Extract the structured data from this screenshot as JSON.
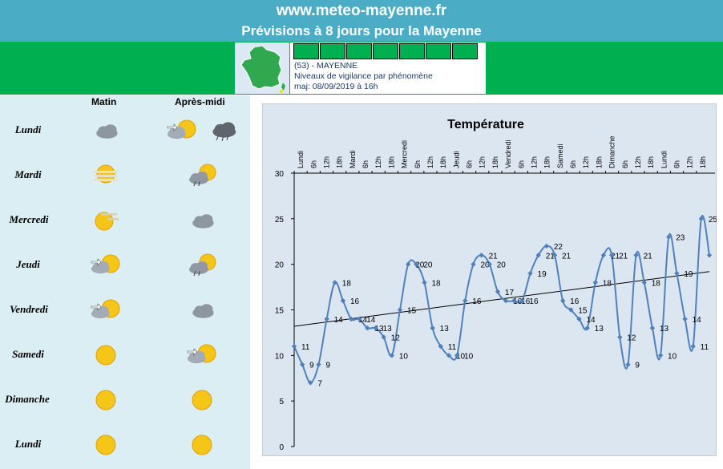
{
  "header": {
    "site": "www.meteo-mayenne.fr",
    "subtitle": "Prévisions à 8 jours pour la Mayenne"
  },
  "vigilance": {
    "department": "(53) - MAYENNE",
    "description": "Niveaux de vigilance par phénomène",
    "updated": "maj: 08/09/2019 à 16h",
    "level_color": "#00b050",
    "phenomena_icons": [
      "wind-icon",
      "rain-flood-icon",
      "thunderstorm-icon",
      "flood-icon",
      "snow-ice-icon",
      "heatwave-icon",
      "cold-icon"
    ]
  },
  "forecast": {
    "col_morning": "Matin",
    "col_afternoon": "Après-midi",
    "days": [
      {
        "name": "Lundi",
        "morning": "cloudy-icon",
        "afternoon": [
          "partly-cloudy-icon",
          "stormy-cloud-icon"
        ]
      },
      {
        "name": "Mardi",
        "morning": "fog-icon",
        "afternoon": [
          "sun-cloud-shower-icon"
        ]
      },
      {
        "name": "Mercredi",
        "morning": "hazy-sun-icon",
        "afternoon": [
          "cloudy-icon"
        ]
      },
      {
        "name": "Jeudi",
        "morning": "partly-cloudy-icon",
        "afternoon": [
          "sun-cloud-shower-icon"
        ]
      },
      {
        "name": "Vendredi",
        "morning": "partly-cloudy-icon",
        "afternoon": [
          "cloudy-icon"
        ]
      },
      {
        "name": "Samedi",
        "morning": "sun-icon",
        "afternoon": [
          "partly-cloudy-icon"
        ]
      },
      {
        "name": "Dimanche",
        "morning": "sun-icon",
        "afternoon": [
          "sun-icon"
        ]
      },
      {
        "name": "Lundi",
        "morning": "sun-icon",
        "afternoon": [
          "sun-icon"
        ]
      }
    ]
  },
  "chart_data": {
    "type": "line",
    "title": "Température",
    "x": [
      "Lundi",
      "6h",
      "12h",
      "18h",
      "Mardi",
      "6h",
      "12h",
      "18h",
      "Mercredi",
      "6h",
      "12h",
      "18h",
      "Jeudi",
      "6h",
      "12h",
      "18h",
      "Vendredi",
      "6h",
      "12h",
      "18h",
      "Samedi",
      "6h",
      "12h",
      "18h",
      "Dimanche",
      "6h",
      "12h",
      "18h",
      "Lundi",
      "6h",
      "12h",
      "18h"
    ],
    "values": [
      11,
      9,
      7,
      9,
      14,
      18,
      16,
      14,
      14,
      13,
      13,
      12,
      10,
      15,
      20,
      20,
      18,
      13,
      11,
      10,
      10,
      16,
      20,
      21,
      20,
      17,
      16,
      16,
      16,
      19,
      21,
      22,
      21,
      16,
      15,
      14,
      13,
      18,
      21,
      21,
      12,
      9,
      21,
      18,
      13,
      10,
      23,
      19,
      14,
      11,
      25,
      21
    ],
    "ylim": [
      0,
      30
    ],
    "yticks": [
      0,
      5,
      10,
      15,
      20,
      25,
      30
    ],
    "trendline": {
      "start": 13.2,
      "end": 19.2
    },
    "line_color": "#4f81bd",
    "trend_color": "#000000",
    "grid": false
  }
}
